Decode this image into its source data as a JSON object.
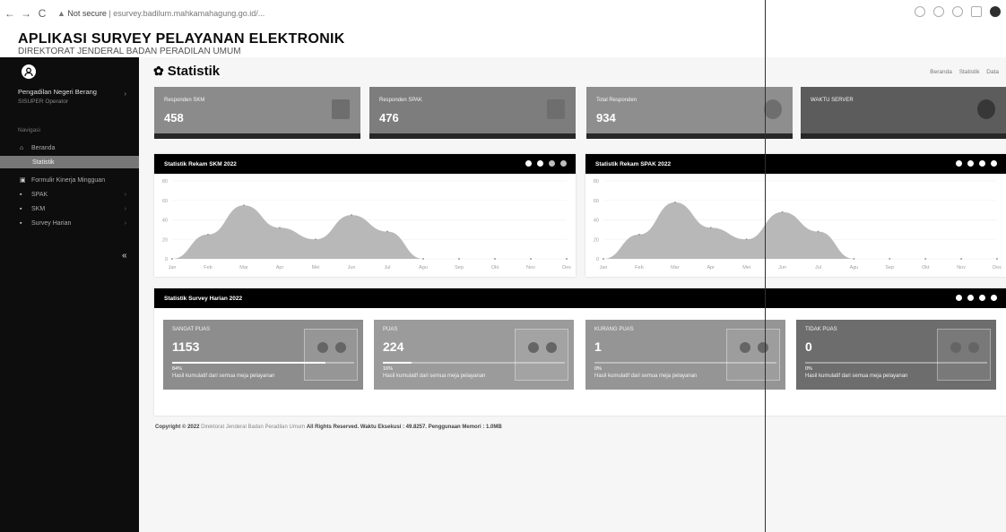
{
  "browser": {
    "security": "Not secure",
    "url": "esurvey.badilum.mahkamahagung.go.id/..."
  },
  "app": {
    "title": "APLIKASI SURVEY PELAYANAN ELEKTRONIK",
    "subtitle": "DIREKTORAT JENDERAL BADAN PERADILAN UMUM"
  },
  "sidebar": {
    "user": "Pengadilan Negeri Berang",
    "role": "SISUPER Operator",
    "header": "Navigasi",
    "items": [
      {
        "label": "Beranda",
        "icon": "home-icon"
      },
      {
        "label": "Statistik",
        "icon": ""
      },
      {
        "label": "Formulir Kinerja Mingguan",
        "icon": "form-icon"
      },
      {
        "label": "SPAK",
        "icon": "file-icon"
      },
      {
        "label": "SKM",
        "icon": "file-icon"
      },
      {
        "label": "Survey Harian",
        "icon": "file-icon"
      }
    ]
  },
  "page": {
    "title": "Statistik",
    "breadcrumb": [
      "Beranda",
      "Statistik",
      "Data"
    ]
  },
  "stats": [
    {
      "label": "Responden SKM",
      "value": "458"
    },
    {
      "label": "Responden SPAK",
      "value": "476"
    },
    {
      "label": "Total Responden",
      "value": "934"
    },
    {
      "label": "WAKTU SERVER",
      "value": ""
    }
  ],
  "charts": [
    {
      "title": "Statistik Rekam SKM 2022"
    },
    {
      "title": "Statistik Rekam SPAK 2022"
    }
  ],
  "chart_data": [
    {
      "type": "area",
      "title": "Statistik Rekam SKM 2022",
      "categories": [
        "Jan",
        "Feb",
        "Mar",
        "Apr",
        "Mei",
        "Jun",
        "Jul",
        "Agu",
        "Sep",
        "Okt",
        "Nov",
        "Des"
      ],
      "y_ticks": [
        "0",
        "20",
        "40",
        "60",
        "80"
      ],
      "ylim": [
        0,
        80
      ],
      "values": [
        0,
        25,
        55,
        32,
        20,
        45,
        28,
        0,
        0,
        0,
        0,
        0
      ]
    },
    {
      "type": "area",
      "title": "Statistik Rekam SPAK 2022",
      "categories": [
        "Jan",
        "Feb",
        "Mar",
        "Apr",
        "Mei",
        "Jun",
        "Jul",
        "Agu",
        "Sep",
        "Okt",
        "Nov",
        "Des"
      ],
      "y_ticks": [
        "0",
        "20",
        "40",
        "60",
        "80"
      ],
      "ylim": [
        0,
        80
      ],
      "values": [
        0,
        25,
        58,
        32,
        20,
        48,
        28,
        0,
        0,
        0,
        0,
        0
      ]
    }
  ],
  "survey": {
    "title": "Statistik Survey Harian 2022",
    "cards": [
      {
        "label": "SANGAT PUAS",
        "value": "1153",
        "pct": "84%",
        "progress": 0.84,
        "desc": "Hasil kumulatif dari semua meja pelayanan"
      },
      {
        "label": "PUAS",
        "value": "224",
        "pct": "16%",
        "progress": 0.16,
        "desc": "Hasil kumulatif dari semua meja pelayanan"
      },
      {
        "label": "KURANG PUAS",
        "value": "1",
        "pct": "0%",
        "progress": 0.0,
        "desc": "Hasil kumulatif dari semua meja pelayanan"
      },
      {
        "label": "TIDAK PUAS",
        "value": "0",
        "pct": "0%",
        "progress": 0.0,
        "desc": "Hasil kumulatif dari semua meja pelayanan"
      }
    ]
  },
  "footer": {
    "copyright": "Copyright © 2022",
    "org": "Direktorat Jenderal Badan Peradilan Umum",
    "rights": "All Rights Reserved.",
    "exec": "Waktu Eksekusi : 49.8257. Penggunaan Memori : 1.0MB"
  }
}
